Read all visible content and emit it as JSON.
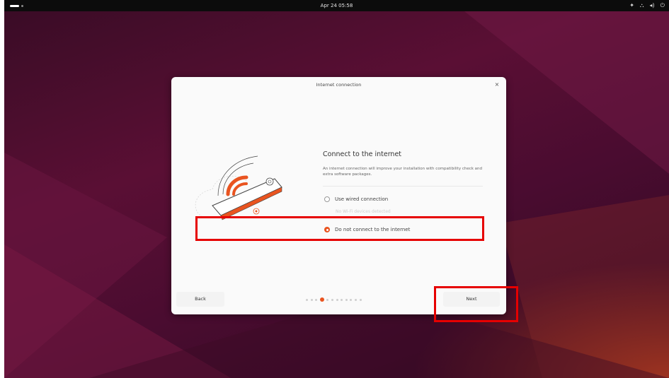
{
  "topbar": {
    "clock": "Apr 24  05:58",
    "tray_icons": [
      "accessibility-icon",
      "network-icon",
      "volume-icon",
      "power-icon"
    ]
  },
  "dialog": {
    "title": "Internet connection",
    "close_label": "×",
    "heading": "Connect to the internet",
    "description": "An internet connection will improve your installation with compatibility check and extra software packages.",
    "options": [
      {
        "label": "Use wired connection",
        "selected": false
      },
      {
        "label": "Do not connect to the internet",
        "selected": true
      }
    ],
    "wifi_note": "No Wi-Fi devices detected",
    "back_label": "Back",
    "next_label": "Next",
    "pager": {
      "total": 12,
      "current": 4
    }
  },
  "colors": {
    "accent": "#e95420",
    "annotation": "#e60000"
  }
}
